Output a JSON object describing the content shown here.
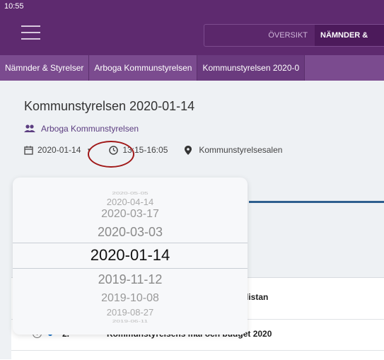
{
  "status_bar": {
    "time": "10:55"
  },
  "header": {
    "tabs": [
      {
        "label": "ÖVERSIKT"
      },
      {
        "label": "NÄMNDER &"
      }
    ]
  },
  "breadcrumb": [
    {
      "label": "Nämnder & Styrelser"
    },
    {
      "label": "Arboga Kommunstyrelsen"
    },
    {
      "label": "Kommunstyrelsen 2020-0"
    }
  ],
  "meeting": {
    "title": "Kommunstyrelsen 2020-01-14",
    "organization": "Arboga Kommunstyrelsen",
    "date": "2020-01-14",
    "time": "13:15-16:05",
    "location": "Kommunstyrelsesalen"
  },
  "date_picker": {
    "options": [
      "2020-05-05",
      "2020-04-14",
      "2020-03-17",
      "2020-03-03",
      "2020-01-14",
      "2019-11-12",
      "2019-10-08",
      "2019-08-27",
      "2019-06-11"
    ],
    "selected": "2020-01-14"
  },
  "agenda": {
    "items": [
      {
        "number": "",
        "title": "gslistan"
      },
      {
        "number": "2.",
        "title": "Kommunstyrelsens mål och budget 2020"
      }
    ]
  },
  "colors": {
    "topbar": "#5e2a6f",
    "breadcrumb": "#7b4b8f",
    "accent_link": "#5b3d80",
    "annotation": "#a01818"
  }
}
